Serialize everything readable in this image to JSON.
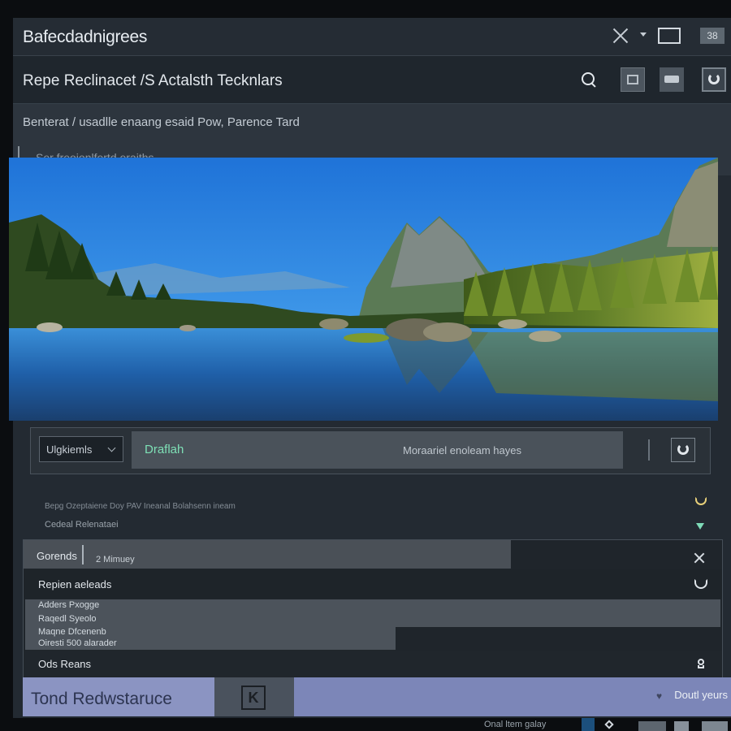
{
  "window": {
    "title": "Bafecdadnigrees",
    "badge": "38"
  },
  "header": {
    "title": "Repe Reclinacet /S Actalsth Tecknlars"
  },
  "breadcrumb": "Benterat / usadlle enaang esaid Pow, Parence  Tard",
  "search": {
    "placeholder": "Ser freoionlfertd eraiths"
  },
  "toolbar": {
    "select_value": "Ulgkiemls",
    "draft_label": "Draflah",
    "meta_text": "Moraariel enoleam hayes"
  },
  "notes": {
    "line1": "Bepg Ozeptaiene Doy PAV Ineanal Bolahsenn ineam",
    "line2": "Cedeal Relenataei"
  },
  "panel": {
    "title": "Gorends",
    "meta": "2 Mimuey",
    "row_sub": "Repien aeleads",
    "items": [
      "Adders Pxogge",
      "Raqedl Syeolo",
      "Maqne Dfcenenb",
      "Oiresti 500 alarader"
    ],
    "footer": "Ods Reans"
  },
  "status": {
    "title": "Tond  Redwstaruce",
    "k_icon_glyph": "K",
    "right_text": "Doutl yeurs",
    "heart_glyph": "♥"
  },
  "taskbar": {
    "text": "Onal ltem galay"
  },
  "colors": {
    "accent_green": "#7ee0b6",
    "status_bar": "#7c86b8",
    "window_bg": "#232a32"
  }
}
